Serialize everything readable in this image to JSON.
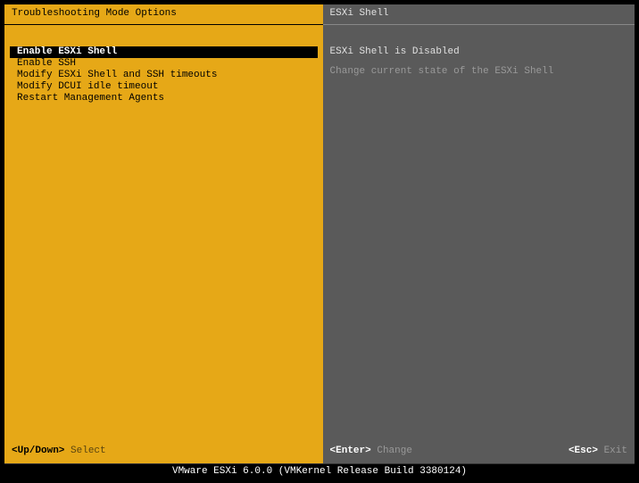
{
  "left_panel": {
    "title": "Troubleshooting Mode Options",
    "menu_items": [
      {
        "label": "Enable ESXi Shell",
        "selected": true
      },
      {
        "label": "Enable SSH",
        "selected": false
      },
      {
        "label": "Modify ESXi Shell and SSH timeouts",
        "selected": false
      },
      {
        "label": "Modify DCUI idle timeout",
        "selected": false
      },
      {
        "label": "Restart Management Agents",
        "selected": false
      }
    ],
    "footer": {
      "key": "<Up/Down>",
      "action": "Select"
    }
  },
  "right_panel": {
    "title": "ESXi Shell",
    "detail_title": "ESXi Shell is Disabled",
    "detail_text": "Change current state of the ESXi Shell",
    "footer_left": {
      "key": "<Enter>",
      "action": "Change"
    },
    "footer_right": {
      "key": "<Esc>",
      "action": "Exit"
    }
  },
  "bottom_bar": "VMware ESXi 6.0.0 (VMKernel Release Build 3380124)"
}
